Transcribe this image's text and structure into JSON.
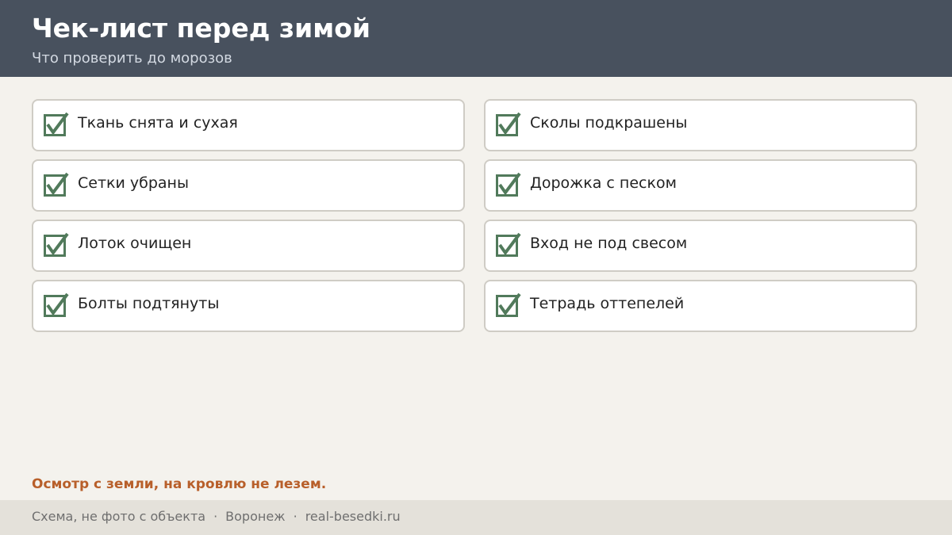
{
  "header": {
    "title": "Чек-лист перед зимой",
    "subtitle": "Что проверить до морозов"
  },
  "checklist": {
    "items": [
      {
        "label": "Ткань снята и сухая",
        "checked": true
      },
      {
        "label": "Сколы подкрашены",
        "checked": true
      },
      {
        "label": "Сетки убраны",
        "checked": true
      },
      {
        "label": "Дорожка с песком",
        "checked": true
      },
      {
        "label": "Лоток очищен",
        "checked": true
      },
      {
        "label": "Вход не под свесом",
        "checked": true
      },
      {
        "label": "Болты подтянуты",
        "checked": true
      },
      {
        "label": "Тетрадь оттепелей",
        "checked": true
      }
    ]
  },
  "note": "Осмотр с земли, на кровлю не лезем.",
  "footer": {
    "caption": "Схема, не фото с объекта",
    "separator": "·",
    "city": "Воронеж",
    "site": "real-besedki.ru"
  },
  "colors": {
    "header_bg": "#48515e",
    "check_green": "#517a5b",
    "note_orange": "#b85f2a",
    "page_bg": "#f4f2ed"
  }
}
